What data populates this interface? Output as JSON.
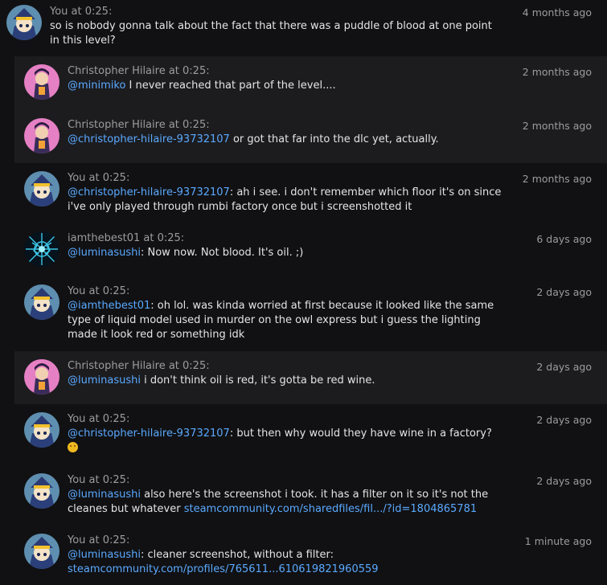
{
  "colors": {
    "background": "#111113",
    "reply_alt": "#1c1c1f",
    "mention": "#5aa9ff",
    "text": "#e4e4e4",
    "meta": "#9c9c9c"
  },
  "comments": [
    {
      "author": "You",
      "at": " at ",
      "time": "0:25",
      "date": "4 months ago",
      "text": "so is nobody gonna talk about the fact that there was a puddle of blood at one point in this level?"
    },
    {
      "author": "Christopher Hilaire",
      "at": " at ",
      "time": "0:25",
      "date": "2 months ago",
      "mention": "@minimiko",
      "text": " I never reached that part of the level...."
    },
    {
      "author": "Christopher Hilaire",
      "at": " at ",
      "time": "0:25",
      "date": "2 months ago",
      "mention": "@christopher-hilaire-93732107",
      "text": " or got that far into the dlc yet, actually."
    },
    {
      "author": "You",
      "at": " at ",
      "time": "0:25",
      "date": "2 months ago",
      "mention": "@christopher-hilaire-93732107",
      "text": ": ah i see. i don't remember which floor it's on since i've only played through rumbi factory once but i screenshotted it"
    },
    {
      "author": "iamthebest01",
      "at": " at ",
      "time": "0:25",
      "date": "6 days ago",
      "mention": "@luminasushi",
      "text": ": Now now. Not blood. It's oil. ;)"
    },
    {
      "author": "You",
      "at": " at ",
      "time": "0:25",
      "date": "2 days ago",
      "mention": "@iamthebest01",
      "text": ": oh lol. was kinda worried at first because it looked like the same type of liquid model used in murder on the owl express but i guess the lighting made it look red or something idk"
    },
    {
      "author": "Christopher Hilaire",
      "at": " at ",
      "time": "0:25",
      "date": "2 days ago",
      "mention": "@luminasushi",
      "text": " i don't think oil is red, it's gotta be red wine."
    },
    {
      "author": "You",
      "at": " at ",
      "time": "0:25",
      "date": "2 days ago",
      "mention": "@christopher-hilaire-93732107",
      "text": ": but then why would they have wine in a factory?",
      "emoji": "confused-emoji"
    },
    {
      "author": "You",
      "at": " at ",
      "time": "0:25",
      "date": "2 days ago",
      "mention": "@luminasushi",
      "text": " also here's the screenshot i took. it has a filter on it so it's not the cleanes but whatever ",
      "link": "steamcommunity.com/sharedfiles/fil.../?id=1804865781"
    },
    {
      "author": "You",
      "at": " at ",
      "time": "0:25",
      "date": "1 minute ago",
      "mention": "@luminasushi",
      "text": ": cleaner screenshot, without a filter:",
      "link": "steamcommunity.com/profiles/765611...610619821960559"
    }
  ]
}
